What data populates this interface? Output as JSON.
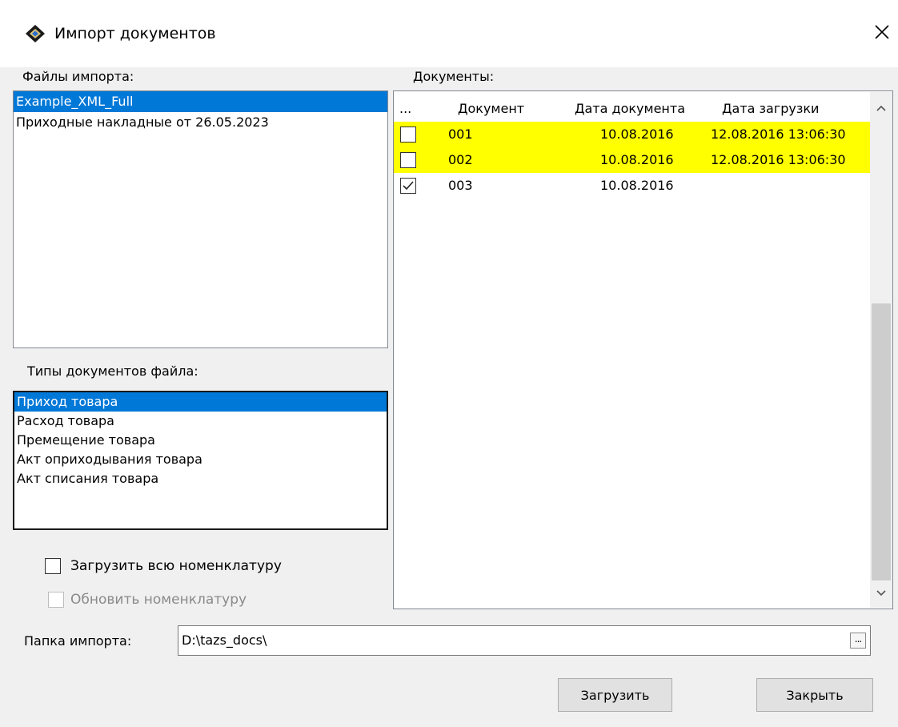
{
  "window": {
    "title": "Импорт документов",
    "close_glyph": "✕"
  },
  "files": {
    "label": "Файлы импорта:",
    "items": [
      "Example_XML_Full",
      "Приходные накладные от 26.05.2023"
    ],
    "selected": 0
  },
  "doc_types": {
    "label": "Типы документов файла:",
    "items": [
      "Приход товара",
      "Расход товара",
      "Премещение товара",
      "Акт оприходывания товара",
      "Акт списания товара"
    ],
    "selected": 0
  },
  "documents": {
    "label": "Документы:",
    "columns": [
      "...",
      "Документ",
      "Дата документа",
      "Дата загрузки"
    ],
    "rows": [
      {
        "checked": false,
        "highlight": true,
        "number": "001",
        "doc_date": "10.08.2016",
        "load_date": "12.08.2016 13:06:30"
      },
      {
        "checked": false,
        "highlight": true,
        "number": "002",
        "doc_date": "10.08.2016",
        "load_date": "12.08.2016 13:06:30"
      },
      {
        "checked": true,
        "highlight": false,
        "number": "003",
        "doc_date": "10.08.2016",
        "load_date": ""
      }
    ],
    "highlight_color": "#ffff00"
  },
  "options": {
    "load_all_label": "Загрузить всю номенклатуру",
    "load_all_checked": false,
    "update_label": "Обновить номенклатуру",
    "update_checked": false,
    "update_enabled": false
  },
  "folder": {
    "label": "Папка импорта:",
    "value": "D:\\tazs_docs\\",
    "browse_label": "..."
  },
  "buttons": {
    "load": "Загрузить",
    "close": "Закрыть"
  },
  "colors": {
    "selection": "#0078d7",
    "highlight": "#ffff00"
  }
}
